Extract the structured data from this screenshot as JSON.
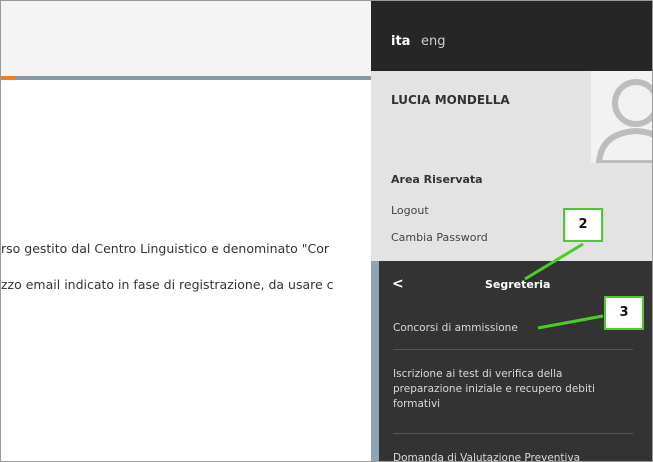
{
  "main": {
    "line1": "rso gestito dal Centro Linguistico e denominato \"Cor",
    "line2": "zzo email indicato in fase di registrazione, da usare c"
  },
  "panel": {
    "lang_active": "ita",
    "lang_other": "eng",
    "user_name": "LUCIA MONDELLA",
    "area_title": "Area Riservata",
    "logout": "Logout",
    "change_password": "Cambia Password",
    "menu": {
      "back": "<",
      "title": "Segreteria",
      "items": [
        "Concorsi di ammissione",
        "Iscrizione ai test di verifica della preparazione iniziale e recupero debiti formativi",
        "Domanda di Valutazione Preventiva"
      ]
    }
  },
  "callouts": {
    "two": "2",
    "three": "3"
  },
  "colors": {
    "accent_orange": "#f07f22",
    "callout_green": "#4ccc2a",
    "menu_bg": "#333333",
    "lang_bar_bg": "#262626"
  },
  "icons": {
    "avatar": "user-placeholder-icon",
    "back": "chevron-left-icon"
  }
}
